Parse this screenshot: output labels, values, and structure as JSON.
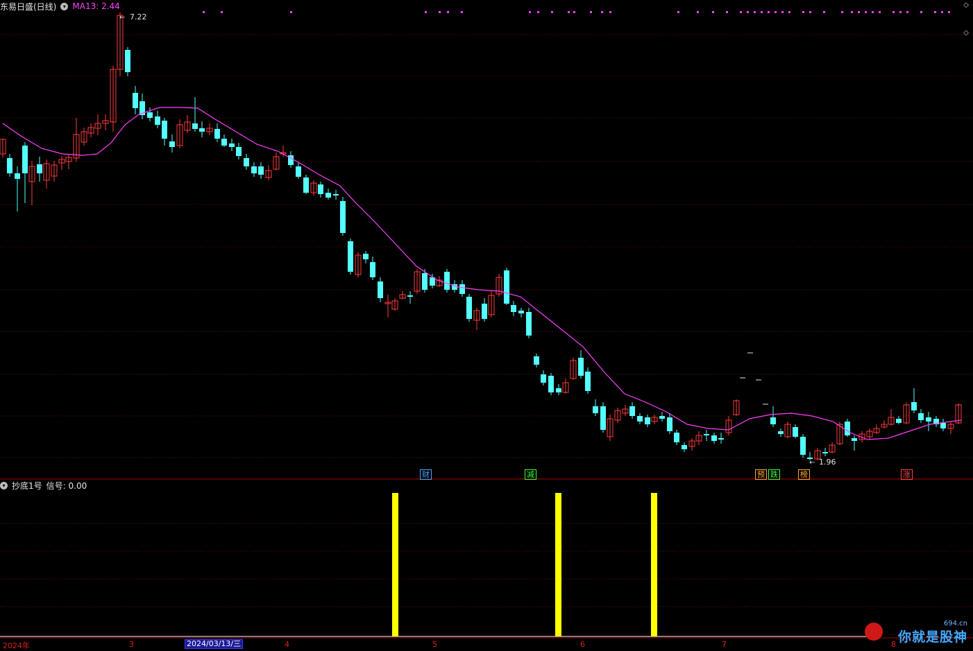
{
  "header": {
    "stock_title": "东易日盛(日线)",
    "ma_label": "MA13: 2.44"
  },
  "price_labels": {
    "high": "7.22",
    "low": "1.96"
  },
  "markers": [
    {
      "text": "财",
      "color": "#4aa8ff"
    },
    {
      "text": "减",
      "color": "#3cff3c"
    },
    {
      "text": "预",
      "color": "#ffaa33"
    },
    {
      "text": "跌",
      "color": "#3cff3c"
    },
    {
      "text": "榜",
      "color": "#ffaa33"
    },
    {
      "text": "涨",
      "color": "#ff4444"
    }
  ],
  "indicator": {
    "title": "抄底1号",
    "signal_label": "信号: 0.00"
  },
  "x_axis": {
    "year": "2024年",
    "months": [
      "3",
      "4",
      "5",
      "6",
      "7",
      "8"
    ],
    "cursor_date": "2024/03/13/三"
  },
  "watermark": {
    "site": "694.cn",
    "text": "你就是股神"
  },
  "colors": {
    "up": "#ff3b3b",
    "down": "#54ffff",
    "ma": "#ff40ff",
    "signal": "#ffff00",
    "grid": "#7a1010",
    "divider": "#b00000"
  }
}
